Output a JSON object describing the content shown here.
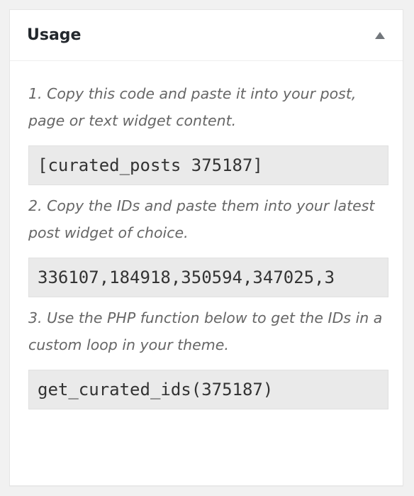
{
  "panel": {
    "title": "Usage",
    "toggle_icon": "triangle-up-icon"
  },
  "steps": [
    {
      "text": "1. Copy this code and paste it into your post, page or text widget content.",
      "code": "[curated_posts 375187]"
    },
    {
      "text": "2. Copy the IDs and paste them into your latest post widget of choice.",
      "code": "336107,184918,350594,347025,3"
    },
    {
      "text": "3. Use the PHP function below to get the IDs in a custom loop in your theme.",
      "code": "get_curated_ids(375187)"
    }
  ],
  "colors": {
    "background": "#f1f1f1",
    "panel": "#ffffff",
    "code_background": "#eaeaea",
    "title": "#23282d",
    "step_text": "#666666"
  }
}
